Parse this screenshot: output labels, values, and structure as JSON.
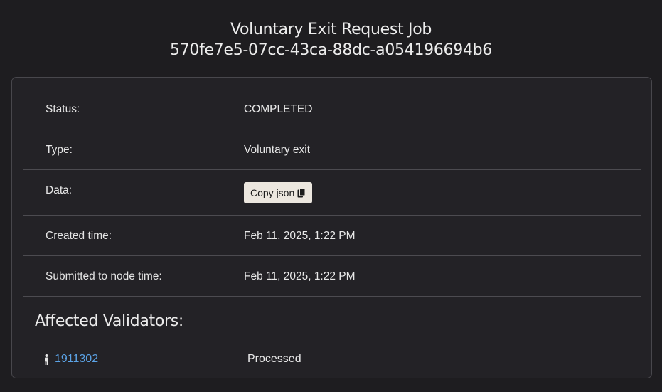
{
  "header": {
    "title_line1": "Voluntary Exit Request Job",
    "title_line2": "570fe7e5-07cc-43ca-88dc-a054196694b6"
  },
  "details": {
    "status_label": "Status:",
    "status_value": "COMPLETED",
    "type_label": "Type:",
    "type_value": "Voluntary exit",
    "data_label": "Data:",
    "copy_button_label": "Copy json",
    "copy_icon": "copy-icon",
    "created_label": "Created time:",
    "created_value": "Feb 11, 2025, 1:22 PM",
    "submitted_label": "Submitted to node time:",
    "submitted_value": "Feb 11, 2025, 1:22 PM"
  },
  "validators": {
    "title": "Affected Validators:",
    "items": [
      {
        "icon": "person-icon",
        "id": "1911302",
        "status": "Processed"
      }
    ]
  },
  "colors": {
    "background": "#1e1d20",
    "card": "#232226",
    "link": "#5ba3e6",
    "button": "#ece7df"
  }
}
